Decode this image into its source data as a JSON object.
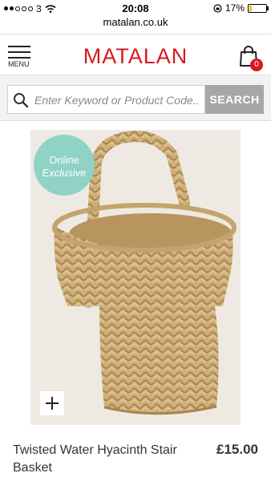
{
  "status_bar": {
    "carrier": "3",
    "time": "20:08",
    "battery": "17%",
    "battery_level": 0.17
  },
  "browser": {
    "url": "matalan.co.uk"
  },
  "header": {
    "menu_label": "MENU",
    "logo": "MATALAN",
    "bag_count": "0"
  },
  "search": {
    "placeholder": "Enter Keyword or Product Code..",
    "button_label": "SEARCH"
  },
  "product": {
    "badge_line1": "Online",
    "badge_line2": "Exclusive",
    "zoom_icon": "plus-icon",
    "title": "Twisted Water Hyacinth Stair Basket",
    "price": "£15.00"
  },
  "colors": {
    "brand": "#d71920",
    "badge": "#8fd2c6",
    "search_button": "#a7a7a7"
  }
}
